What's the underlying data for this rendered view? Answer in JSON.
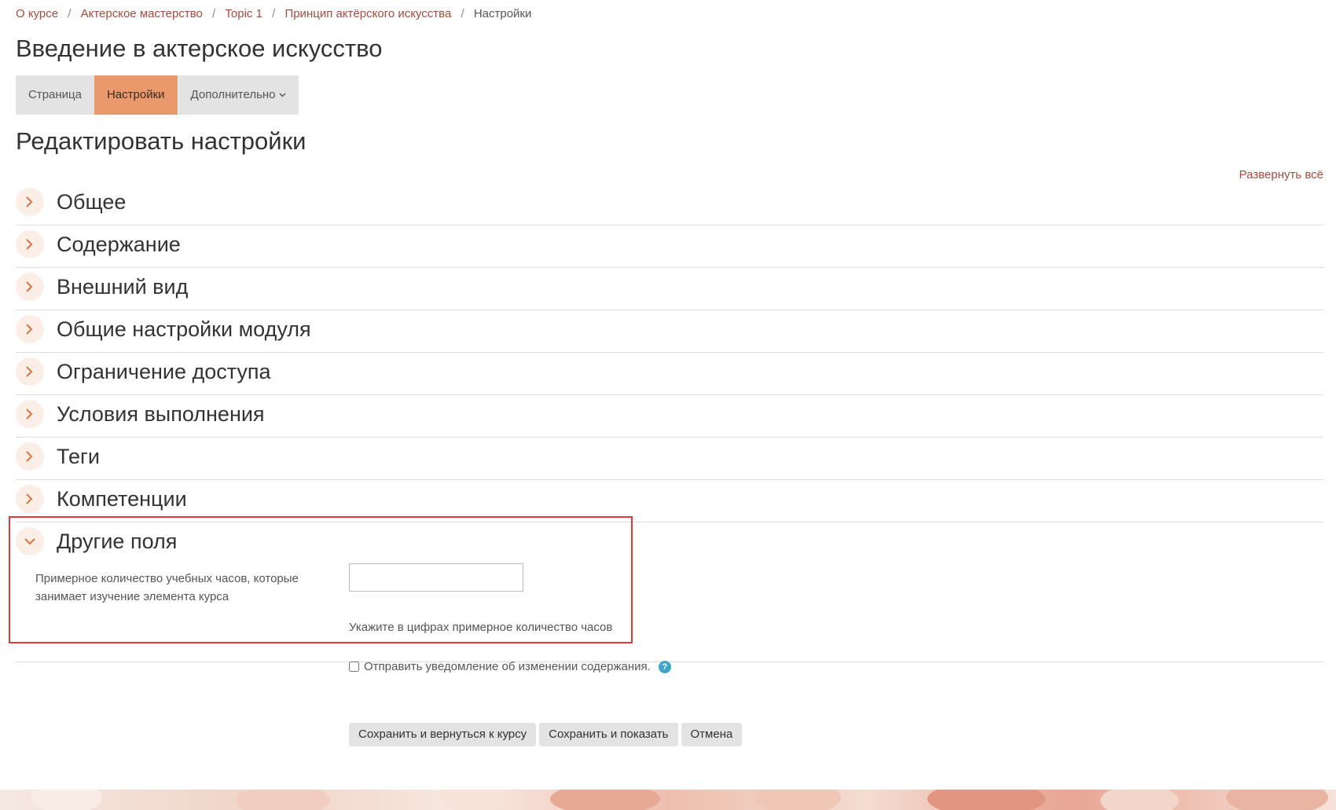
{
  "breadcrumb": {
    "items": [
      "О курсе",
      "Актерское мастерство",
      "Topic 1",
      "Принцип актёрского искусства"
    ],
    "current": "Настройки",
    "separator": "/"
  },
  "page_title": "Введение в актерское искусство",
  "tabs": {
    "page": "Страница",
    "settings": "Настройки",
    "more": "Дополнительно"
  },
  "section_title": "Редактировать настройки",
  "expand_all": "Развернуть всё",
  "sections": {
    "general": "Общее",
    "content": "Содержание",
    "appearance": "Внешний вид",
    "module_settings": "Общие настройки модуля",
    "access": "Ограничение доступа",
    "completion": "Условия выполнения",
    "tags": "Теги",
    "competencies": "Компетенции",
    "other_fields": "Другие поля"
  },
  "other_fields": {
    "hours_label": "Примерное количество учебных часов, которые занимает изучение элемента курса",
    "hours_value": "",
    "hours_hint": "Укажите в цифрах примерное количество часов"
  },
  "notify": {
    "label": "Отправить уведомление об изменении содержания.",
    "checked": false
  },
  "buttons": {
    "save_return": "Сохранить и вернуться к курсу",
    "save_display": "Сохранить и показать",
    "cancel": "Отмена"
  },
  "colors": {
    "accent": "#e9996c",
    "link": "#a84a3c",
    "highlight_border": "#e53935",
    "help": "#3ea7c9"
  }
}
